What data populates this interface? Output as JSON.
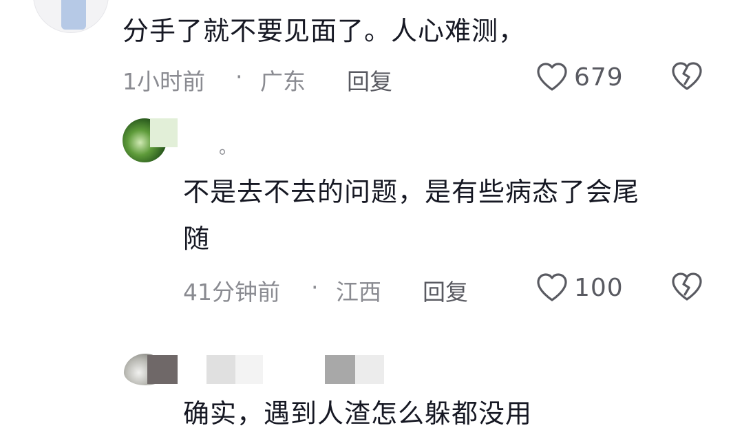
{
  "comment1": {
    "text": "分手了就不要见面了。人心难测，",
    "time": "1小时前",
    "separator": "·",
    "location": "广东",
    "reply_label": "回复",
    "like_count": "679",
    "icons": {
      "like": "heart-outline-icon",
      "dislike": "broken-heart-icon"
    }
  },
  "reply1": {
    "username": "。",
    "text_line1": "不是去不去的问题，是有些病态了会尾",
    "text_line2": "随",
    "time": "41分钟前",
    "separator": "·",
    "location": "江西",
    "reply_label": "回复",
    "like_count": "100",
    "icons": {
      "like": "heart-outline-icon",
      "dislike": "broken-heart-icon"
    }
  },
  "reply2": {
    "text": "确实，遇到人渣怎么躲都没用"
  },
  "colors": {
    "text_primary": "#161823",
    "text_secondary": "#8a8b91",
    "icon": "#595a61"
  }
}
